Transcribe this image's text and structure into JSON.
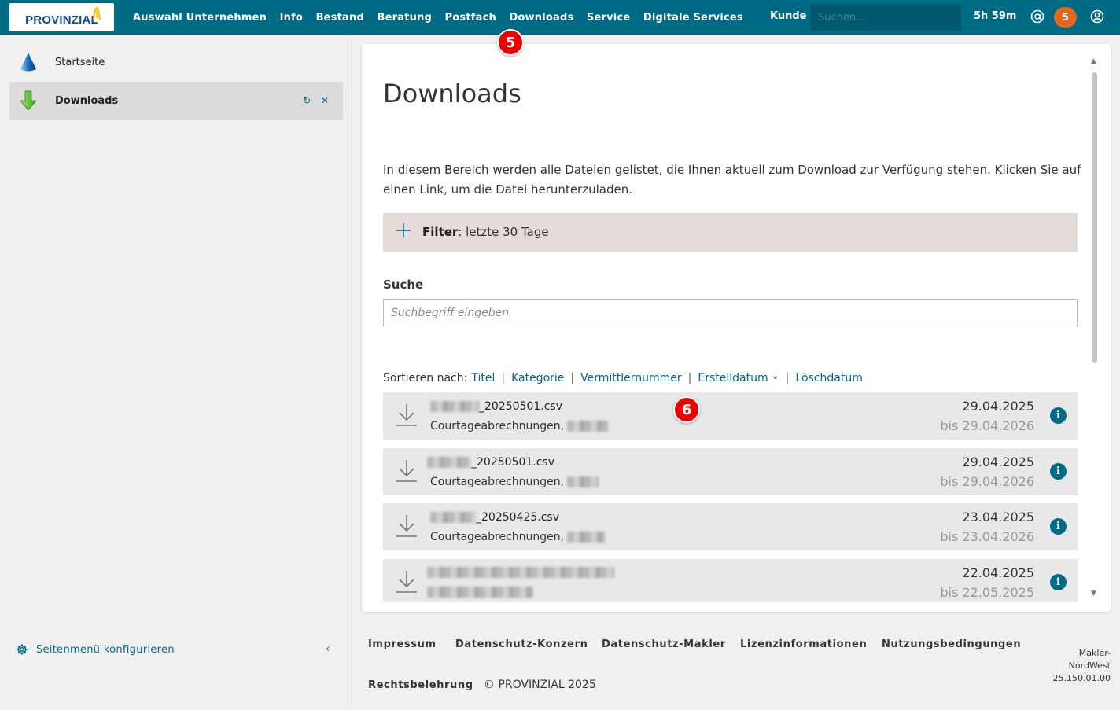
{
  "brand": {
    "logo_text": "PROVINZIAL",
    "primary_color": "#006b84",
    "badge_color": "#e3681e",
    "marker_color": "#e00000"
  },
  "topnav": {
    "items": [
      "Auswahl Unternehmen",
      "Info",
      "Bestand",
      "Beratung",
      "Postfach",
      "Downloads",
      "Service",
      "Digitale Services"
    ],
    "kunde_label": "Kunde",
    "search_placeholder": "Suchen...",
    "session_timer": "5h 59m",
    "notification_count": "5",
    "icons": [
      "at-sign-icon",
      "user-circle-icon"
    ]
  },
  "sidebar": {
    "items": [
      {
        "label": "Startseite",
        "icon": "cone-icon"
      },
      {
        "label": "Downloads",
        "icon": "download-arrow-icon",
        "active": true
      }
    ],
    "refresh_icon": "↻",
    "close_icon": "✕",
    "config_label": "Seitenmenü konfigurieren",
    "collapse_icon": "‹"
  },
  "main": {
    "title": "Downloads",
    "intro": "In diesem Bereich werden alle Dateien gelistet, die Ihnen aktuell zum Download zur Verfügung stehen. Klicken Sie auf einen Link, um die Datei herunterzuladen.",
    "filter": {
      "label": "Filter",
      "value": ": letzte 30 Tage"
    },
    "search": {
      "label": "Suche",
      "placeholder": "Suchbegriff eingeben"
    },
    "sort": {
      "label": "Sortieren nach:",
      "options": [
        "Titel",
        "Kategorie",
        "Vermittlernummer",
        "Erstelldatum",
        "Löschdatum"
      ],
      "active_chevron": "⌄"
    },
    "rows": [
      {
        "title_suffix": "_20250501.csv",
        "category": "Courtageabrechnungen,",
        "date": "29.04.2025",
        "until": "bis 29.04.2026",
        "info": "i"
      },
      {
        "title_suffix": "_20250501.csv",
        "category": "Courtageabrechnungen,",
        "date": "29.04.2025",
        "until": "bis 29.04.2026",
        "info": "i"
      },
      {
        "title_suffix": "_20250425.csv",
        "category": "Courtageabrechnungen,",
        "date": "23.04.2025",
        "until": "bis 23.04.2026",
        "info": "i"
      },
      {
        "title_suffix": "",
        "category": "",
        "date": "22.04.2025",
        "until": "bis 22.05.2025",
        "info": "i"
      }
    ]
  },
  "markers": [
    "5",
    "6"
  ],
  "footer": {
    "links": [
      "Impressum",
      "Datenschutz-Konzern",
      "Datenschutz-Makler",
      "Lizenzinformationen",
      "Nutzungsbedingungen",
      "Rechtsbelehrung"
    ],
    "copyright": "© PROVINZIAL 2025",
    "version": [
      "Makler-",
      "NordWest",
      "25.150.01.00"
    ]
  }
}
